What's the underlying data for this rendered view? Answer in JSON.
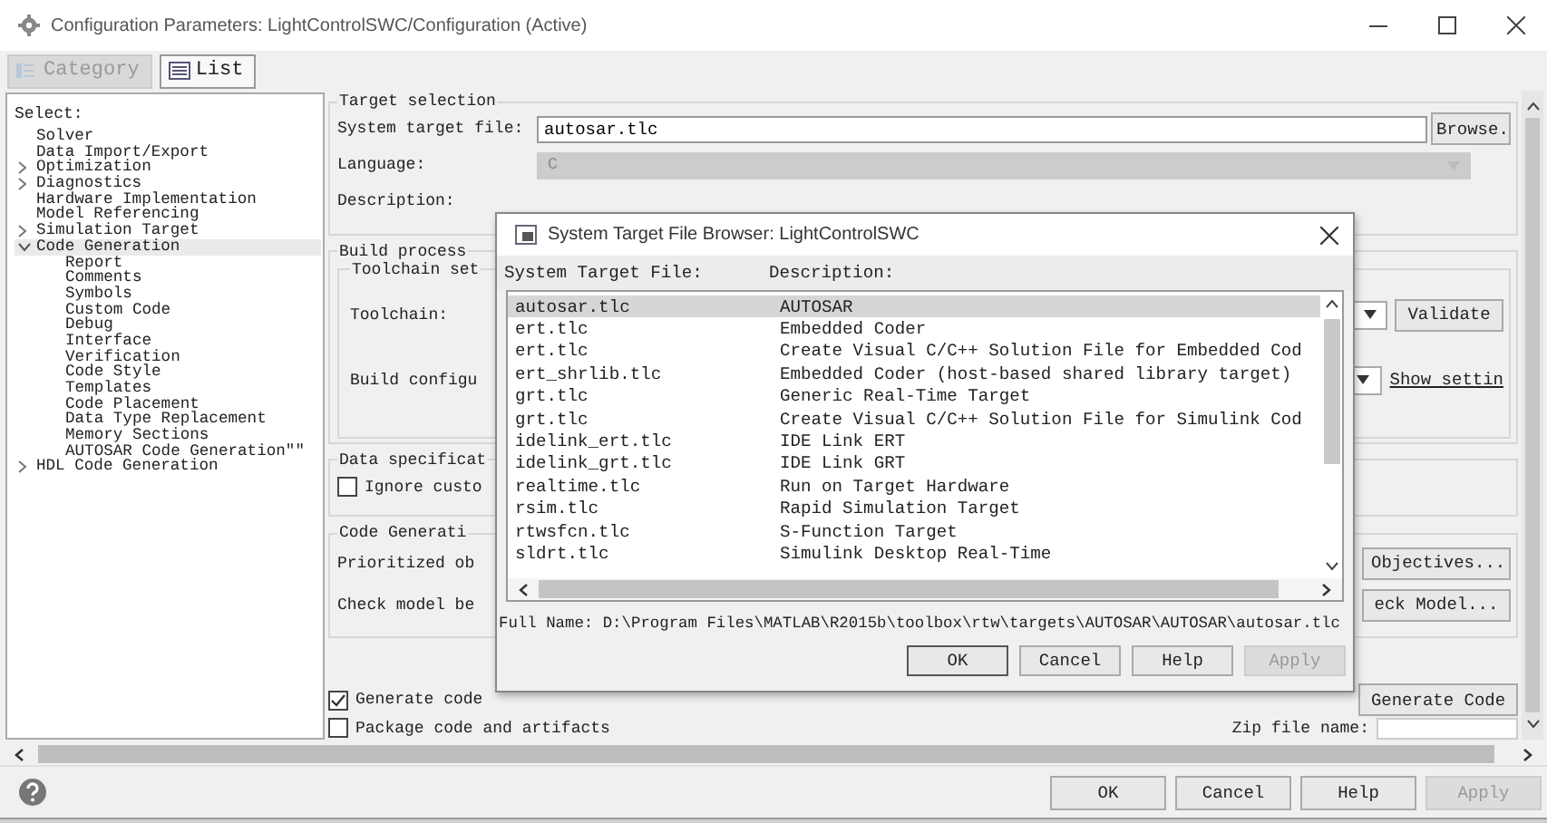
{
  "window": {
    "title": "Configuration Parameters: LightControlSWC/Configuration (Active)"
  },
  "view_buttons": [
    {
      "label": "Category",
      "disabled": true
    },
    {
      "label": "List",
      "disabled": false
    }
  ],
  "tree": {
    "title": "Select:",
    "items": [
      {
        "label": "Solver",
        "kind": "leaf",
        "selected": false
      },
      {
        "label": "Data Import/Export",
        "kind": "leaf",
        "selected": false
      },
      {
        "label": "Optimization",
        "kind": "collapsed",
        "selected": false
      },
      {
        "label": "Diagnostics",
        "kind": "collapsed",
        "selected": false
      },
      {
        "label": "Hardware Implementation",
        "kind": "leaf",
        "selected": false
      },
      {
        "label": "Model Referencing",
        "kind": "leaf",
        "selected": false
      },
      {
        "label": "Simulation Target",
        "kind": "collapsed",
        "selected": false
      },
      {
        "label": "Code Generation",
        "kind": "expanded",
        "selected": true,
        "children": [
          {
            "label": "Report",
            "selected": false
          },
          {
            "label": "Comments",
            "selected": false
          },
          {
            "label": "Symbols",
            "selected": false
          },
          {
            "label": "Custom Code",
            "selected": false
          },
          {
            "label": "Debug",
            "selected": false
          },
          {
            "label": "Interface",
            "selected": false
          },
          {
            "label": "Verification",
            "selected": false
          },
          {
            "label": "Code Style",
            "selected": false
          },
          {
            "label": "Templates",
            "selected": false
          },
          {
            "label": "Code Placement",
            "selected": false
          },
          {
            "label": "Data Type Replacement",
            "selected": false
          },
          {
            "label": "Memory Sections",
            "selected": false
          },
          {
            "label": "AUTOSAR Code Generation\"\"",
            "selected": false
          }
        ]
      },
      {
        "label": "HDL Code Generation",
        "kind": "collapsed",
        "selected": false
      }
    ]
  },
  "target_selection": {
    "legend": "Target selection",
    "system_target_file": {
      "label": "System target file:",
      "value": "autosar.tlc"
    },
    "browse_button": "Browse.",
    "language": {
      "label": "Language:",
      "value": "C",
      "disabled": true
    },
    "description_label": "Description:"
  },
  "build_process": {
    "legend": "Build process",
    "toolchain_settings": {
      "legend": "Toolchain set",
      "toolchain_label": "Toolchain:",
      "validate_button": "Validate",
      "build_configuration_label": "Build configu",
      "show_settings_link": "Show settin"
    }
  },
  "data_specification": {
    "legend": "Data specificat",
    "ignore_checkbox": {
      "label": "Ignore custo",
      "checked": false
    }
  },
  "code_generation": {
    "legend": "Code Generati",
    "prioritized_label": "Prioritized ob",
    "objectives_button": "Objectives...",
    "check_model_label": "Check model be",
    "check_model_button": "eck Model..."
  },
  "generate_code_only": {
    "label": "Generate code",
    "checked": true
  },
  "generate_code_button": "Generate Code",
  "package_code": {
    "label": "Package code and artifacts",
    "checked": false
  },
  "zip_file_label": "Zip file name:",
  "buttons": [
    {
      "label": "OK",
      "disabled": false
    },
    {
      "label": "Cancel",
      "disabled": false
    },
    {
      "label": "Help",
      "disabled": false
    },
    {
      "label": "Apply",
      "disabled": true
    }
  ],
  "dialog": {
    "title": "System Target File Browser: LightControlSWC",
    "columns": [
      "System Target File:",
      "Description:"
    ],
    "rows": [
      {
        "file": "autosar.tlc",
        "description": "AUTOSAR",
        "selected": true
      },
      {
        "file": "ert.tlc",
        "description": "Embedded Coder",
        "selected": false
      },
      {
        "file": "ert.tlc",
        "description": "Create Visual C/C++ Solution File for Embedded Cod",
        "selected": false
      },
      {
        "file": "ert_shrlib.tlc",
        "description": "Embedded Coder (host-based shared library target)",
        "selected": false
      },
      {
        "file": "grt.tlc",
        "description": "Generic Real-Time Target",
        "selected": false
      },
      {
        "file": "grt.tlc",
        "description": "Create Visual C/C++ Solution File for Simulink Cod",
        "selected": false
      },
      {
        "file": "idelink_ert.tlc",
        "description": "IDE Link ERT",
        "selected": false
      },
      {
        "file": "idelink_grt.tlc",
        "description": "IDE Link GRT",
        "selected": false
      },
      {
        "file": "realtime.tlc",
        "description": "Run on Target Hardware",
        "selected": false
      },
      {
        "file": "rsim.tlc",
        "description": "Rapid Simulation Target",
        "selected": false
      },
      {
        "file": "rtwsfcn.tlc",
        "description": "S-Function Target",
        "selected": false
      },
      {
        "file": "sldrt.tlc",
        "description": "Simulink Desktop Real-Time",
        "selected": false
      }
    ],
    "full_name": "Full Name: D:\\Program Files\\MATLAB\\R2015b\\toolbox\\rtw\\targets\\AUTOSAR\\AUTOSAR\\autosar.tlc",
    "buttons": [
      {
        "label": "OK",
        "disabled": false
      },
      {
        "label": "Cancel",
        "disabled": false
      },
      {
        "label": "Help",
        "disabled": false
      },
      {
        "label": "Apply",
        "disabled": true
      }
    ]
  }
}
